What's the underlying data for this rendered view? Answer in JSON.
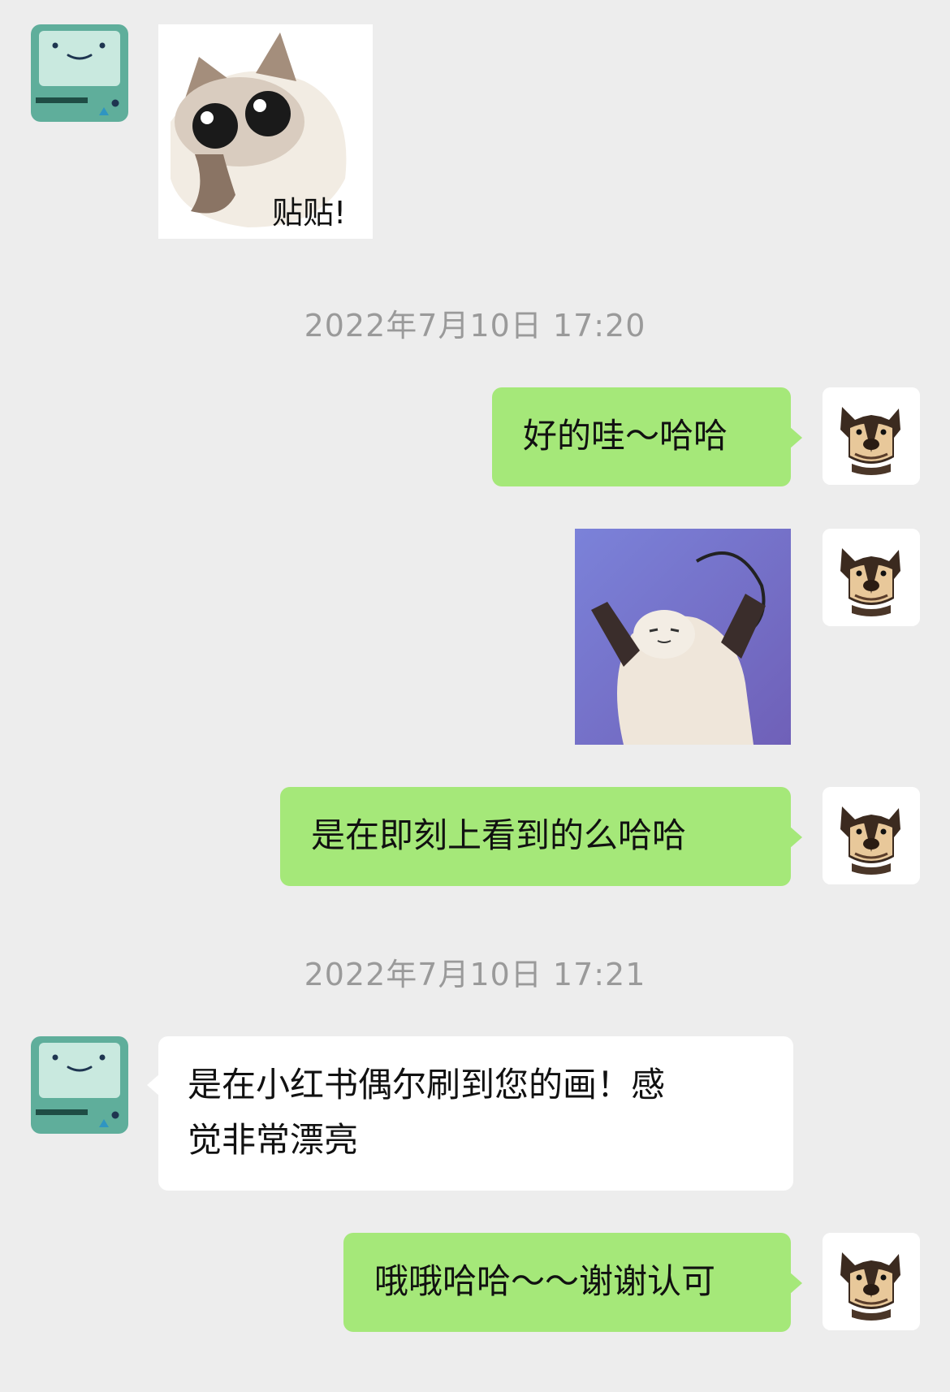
{
  "messages": [
    {
      "sender": "them",
      "type": "sticker",
      "caption": "贴贴!",
      "icon": "cat-sticker-icon"
    },
    {
      "type": "timestamp",
      "text": "2022年7月10日 17:20"
    },
    {
      "sender": "me",
      "type": "text",
      "text": "好的哇～哈哈"
    },
    {
      "sender": "me",
      "type": "sticker",
      "icon": "cat-stretching-sticker-icon"
    },
    {
      "sender": "me",
      "type": "text",
      "text": "是在即刻上看到的么哈哈"
    },
    {
      "type": "timestamp",
      "text": "2022年7月10日 17:21"
    },
    {
      "sender": "them",
      "type": "text",
      "lines": [
        "是在小红书偶尔刷到您的画！感",
        "觉非常漂亮"
      ]
    },
    {
      "sender": "me",
      "type": "text",
      "text": "哦哦哈哈～～谢谢认可"
    }
  ],
  "colors": {
    "background": "#ededed",
    "my_bubble": "#a5e879",
    "their_bubble": "#ffffff",
    "timestamp": "#9a9a9a"
  },
  "avatars": {
    "them": "robot-avatar-icon",
    "me": "dog-avatar-icon"
  }
}
